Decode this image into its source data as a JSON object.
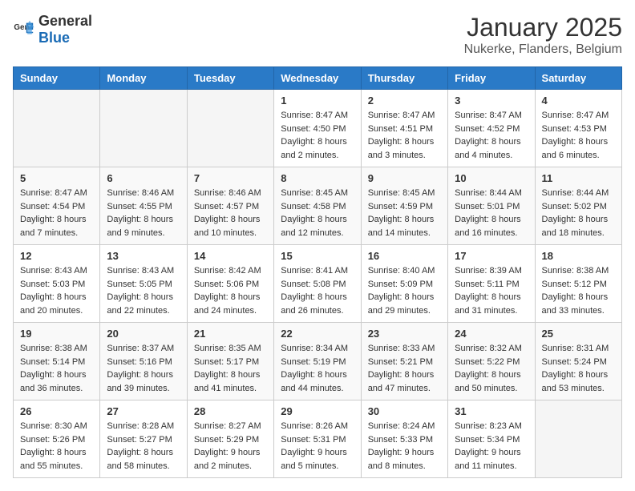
{
  "header": {
    "logo_general": "General",
    "logo_blue": "Blue",
    "month_year": "January 2025",
    "location": "Nukerke, Flanders, Belgium"
  },
  "days_of_week": [
    "Sunday",
    "Monday",
    "Tuesday",
    "Wednesday",
    "Thursday",
    "Friday",
    "Saturday"
  ],
  "weeks": [
    [
      {
        "day": "",
        "content": ""
      },
      {
        "day": "",
        "content": ""
      },
      {
        "day": "",
        "content": ""
      },
      {
        "day": "1",
        "content": "Sunrise: 8:47 AM\nSunset: 4:50 PM\nDaylight: 8 hours\nand 2 minutes."
      },
      {
        "day": "2",
        "content": "Sunrise: 8:47 AM\nSunset: 4:51 PM\nDaylight: 8 hours\nand 3 minutes."
      },
      {
        "day": "3",
        "content": "Sunrise: 8:47 AM\nSunset: 4:52 PM\nDaylight: 8 hours\nand 4 minutes."
      },
      {
        "day": "4",
        "content": "Sunrise: 8:47 AM\nSunset: 4:53 PM\nDaylight: 8 hours\nand 6 minutes."
      }
    ],
    [
      {
        "day": "5",
        "content": "Sunrise: 8:47 AM\nSunset: 4:54 PM\nDaylight: 8 hours\nand 7 minutes."
      },
      {
        "day": "6",
        "content": "Sunrise: 8:46 AM\nSunset: 4:55 PM\nDaylight: 8 hours\nand 9 minutes."
      },
      {
        "day": "7",
        "content": "Sunrise: 8:46 AM\nSunset: 4:57 PM\nDaylight: 8 hours\nand 10 minutes."
      },
      {
        "day": "8",
        "content": "Sunrise: 8:45 AM\nSunset: 4:58 PM\nDaylight: 8 hours\nand 12 minutes."
      },
      {
        "day": "9",
        "content": "Sunrise: 8:45 AM\nSunset: 4:59 PM\nDaylight: 8 hours\nand 14 minutes."
      },
      {
        "day": "10",
        "content": "Sunrise: 8:44 AM\nSunset: 5:01 PM\nDaylight: 8 hours\nand 16 minutes."
      },
      {
        "day": "11",
        "content": "Sunrise: 8:44 AM\nSunset: 5:02 PM\nDaylight: 8 hours\nand 18 minutes."
      }
    ],
    [
      {
        "day": "12",
        "content": "Sunrise: 8:43 AM\nSunset: 5:03 PM\nDaylight: 8 hours\nand 20 minutes."
      },
      {
        "day": "13",
        "content": "Sunrise: 8:43 AM\nSunset: 5:05 PM\nDaylight: 8 hours\nand 22 minutes."
      },
      {
        "day": "14",
        "content": "Sunrise: 8:42 AM\nSunset: 5:06 PM\nDaylight: 8 hours\nand 24 minutes."
      },
      {
        "day": "15",
        "content": "Sunrise: 8:41 AM\nSunset: 5:08 PM\nDaylight: 8 hours\nand 26 minutes."
      },
      {
        "day": "16",
        "content": "Sunrise: 8:40 AM\nSunset: 5:09 PM\nDaylight: 8 hours\nand 29 minutes."
      },
      {
        "day": "17",
        "content": "Sunrise: 8:39 AM\nSunset: 5:11 PM\nDaylight: 8 hours\nand 31 minutes."
      },
      {
        "day": "18",
        "content": "Sunrise: 8:38 AM\nSunset: 5:12 PM\nDaylight: 8 hours\nand 33 minutes."
      }
    ],
    [
      {
        "day": "19",
        "content": "Sunrise: 8:38 AM\nSunset: 5:14 PM\nDaylight: 8 hours\nand 36 minutes."
      },
      {
        "day": "20",
        "content": "Sunrise: 8:37 AM\nSunset: 5:16 PM\nDaylight: 8 hours\nand 39 minutes."
      },
      {
        "day": "21",
        "content": "Sunrise: 8:35 AM\nSunset: 5:17 PM\nDaylight: 8 hours\nand 41 minutes."
      },
      {
        "day": "22",
        "content": "Sunrise: 8:34 AM\nSunset: 5:19 PM\nDaylight: 8 hours\nand 44 minutes."
      },
      {
        "day": "23",
        "content": "Sunrise: 8:33 AM\nSunset: 5:21 PM\nDaylight: 8 hours\nand 47 minutes."
      },
      {
        "day": "24",
        "content": "Sunrise: 8:32 AM\nSunset: 5:22 PM\nDaylight: 8 hours\nand 50 minutes."
      },
      {
        "day": "25",
        "content": "Sunrise: 8:31 AM\nSunset: 5:24 PM\nDaylight: 8 hours\nand 53 minutes."
      }
    ],
    [
      {
        "day": "26",
        "content": "Sunrise: 8:30 AM\nSunset: 5:26 PM\nDaylight: 8 hours\nand 55 minutes."
      },
      {
        "day": "27",
        "content": "Sunrise: 8:28 AM\nSunset: 5:27 PM\nDaylight: 8 hours\nand 58 minutes."
      },
      {
        "day": "28",
        "content": "Sunrise: 8:27 AM\nSunset: 5:29 PM\nDaylight: 9 hours\nand 2 minutes."
      },
      {
        "day": "29",
        "content": "Sunrise: 8:26 AM\nSunset: 5:31 PM\nDaylight: 9 hours\nand 5 minutes."
      },
      {
        "day": "30",
        "content": "Sunrise: 8:24 AM\nSunset: 5:33 PM\nDaylight: 9 hours\nand 8 minutes."
      },
      {
        "day": "31",
        "content": "Sunrise: 8:23 AM\nSunset: 5:34 PM\nDaylight: 9 hours\nand 11 minutes."
      },
      {
        "day": "",
        "content": ""
      }
    ]
  ]
}
